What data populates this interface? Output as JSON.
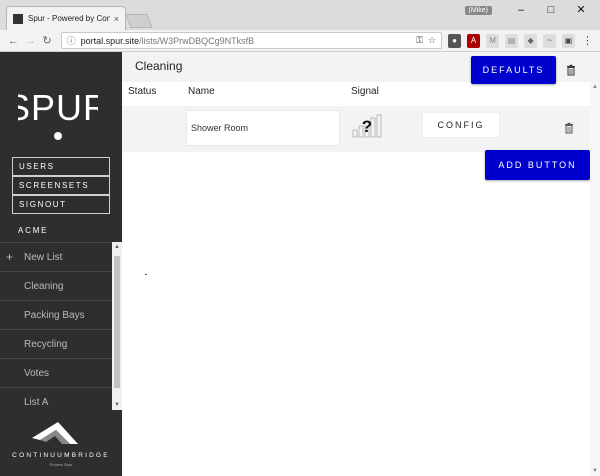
{
  "browser": {
    "tab_title": "Spur - Powered by Conti",
    "tab_close": "×",
    "user_badge": "(Mike)",
    "win_min": "–",
    "win_max": "□",
    "win_close": "✕",
    "url_host": "portal.spur.site",
    "url_path": "/lists/W3PrwDBQCg9NTksfB"
  },
  "sidebar": {
    "logo_text": "SPUR",
    "nav": [
      "USERS",
      "SCREENSETS",
      "SIGNOUT"
    ],
    "org": "ACME",
    "new_list_label": "New List",
    "lists": [
      "Cleaning",
      "Packing Bays",
      "Recycling",
      "Votes",
      "List A"
    ],
    "footer_brand": "CONTINUUMBRIDGE",
    "footer_tag": "Powers Spur"
  },
  "main": {
    "title": "Cleaning",
    "defaults_label": "DEFAULTS",
    "columns": {
      "status": "Status",
      "name": "Name",
      "signal": "Signal"
    },
    "rows": [
      {
        "name": "Shower Room",
        "signal_glyph": "?",
        "config_label": "CONFIG"
      }
    ],
    "add_button_label": "ADD BUTTON"
  },
  "colors": {
    "accent_blue": "#0000cc",
    "sidebar_bg": "#2e2e2e",
    "header_bg": "#f3f3f3"
  }
}
